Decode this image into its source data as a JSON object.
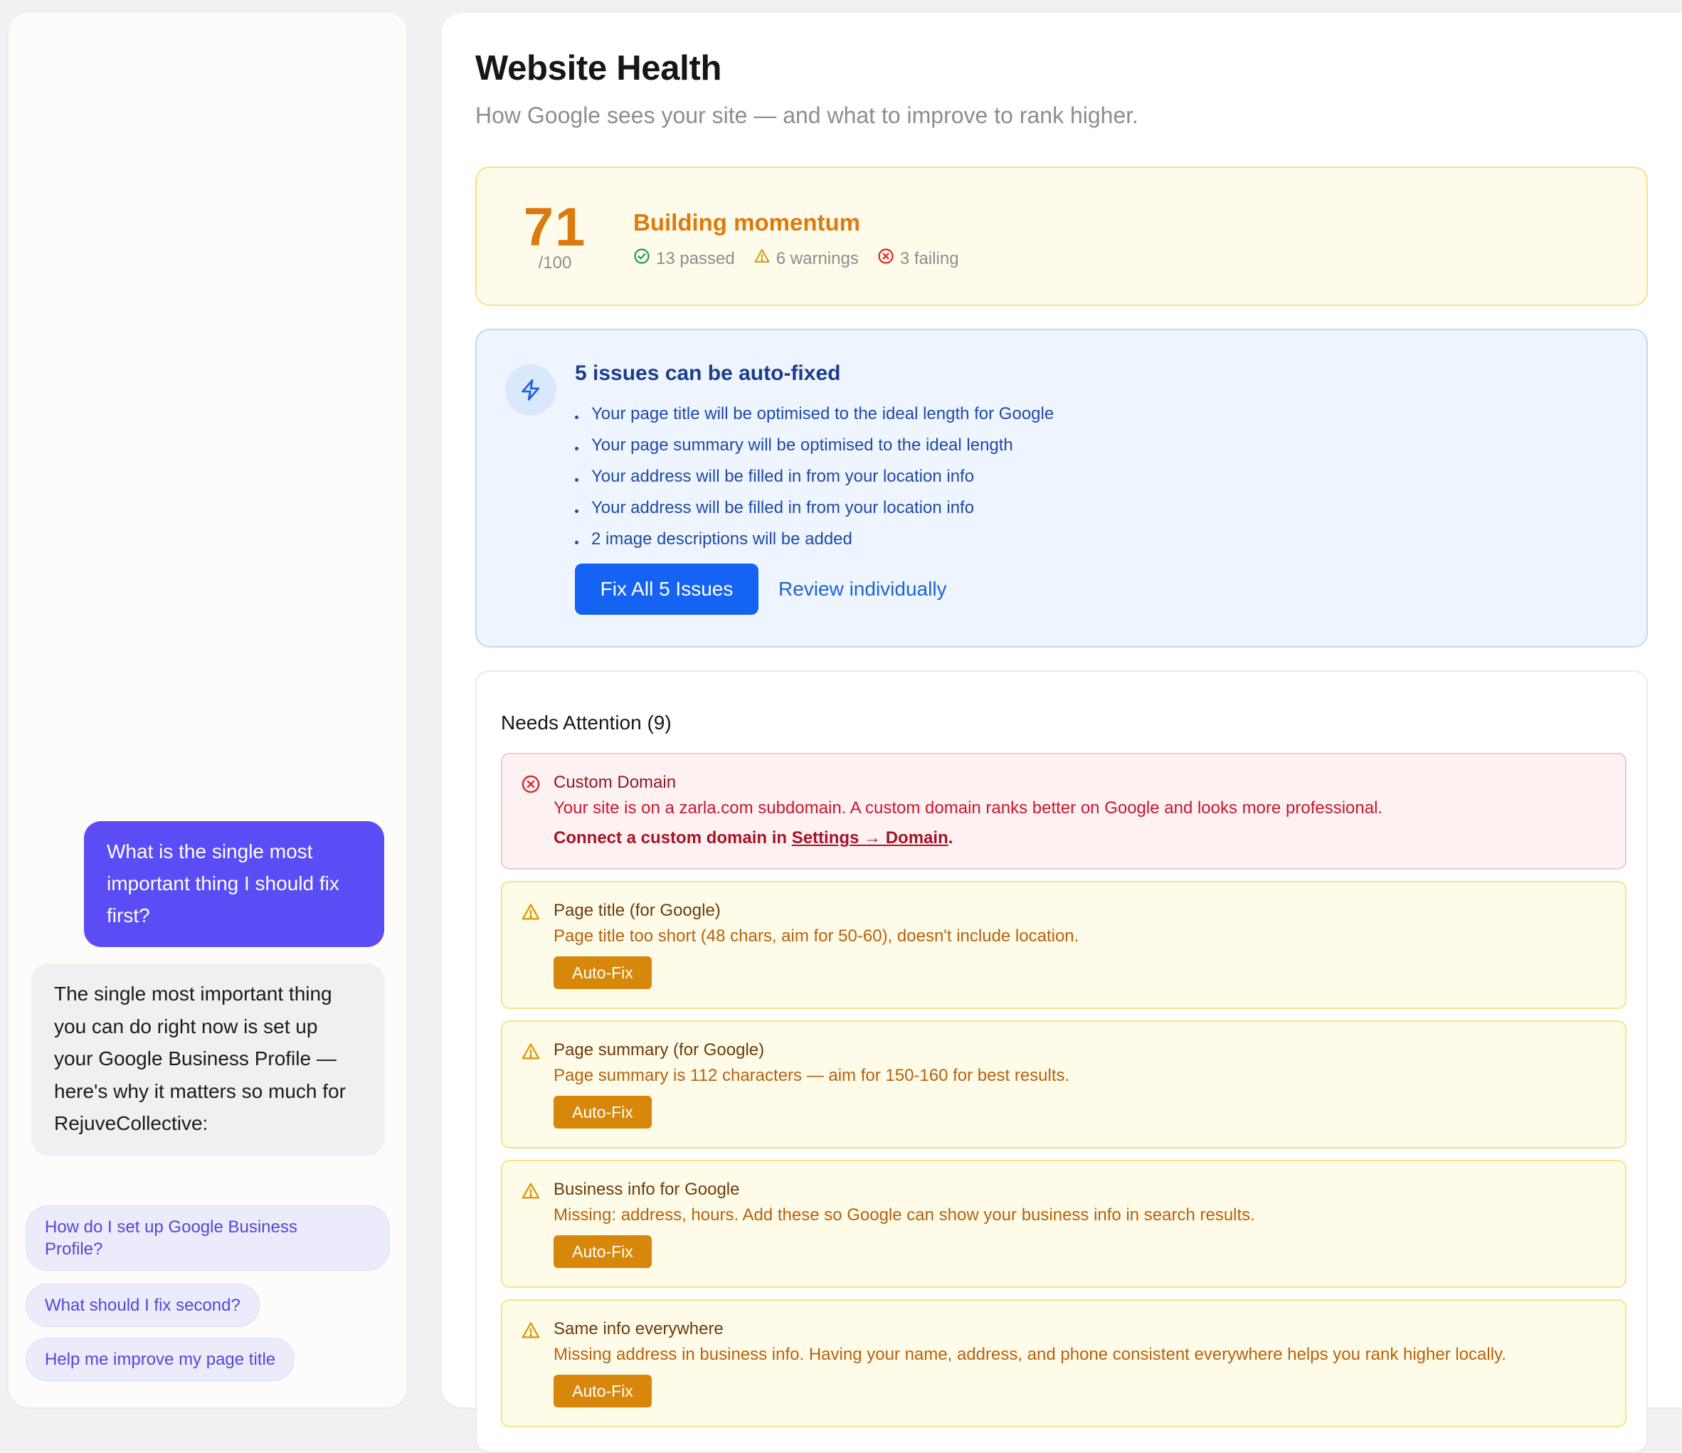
{
  "chat": {
    "user_message": "What is the single most important thing I should fix first?",
    "bot_message": "The single most important thing you can do right now is set up your Google Business Profile — here's why it matters so much for RejuveCollective:",
    "suggestions": [
      "How do I set up Google Business Profile?",
      "What should I fix second?",
      "Help me improve my page title"
    ]
  },
  "header": {
    "title": "Website Health",
    "subtitle": "How Google sees your site — and what to improve to rank higher."
  },
  "score": {
    "value": "71",
    "max": "/100",
    "label": "Building momentum",
    "passed": "13 passed",
    "warnings": "6 warnings",
    "failing": "3 failing",
    "colors": {
      "accent": "#dd7a0c",
      "pass": "#16a34a",
      "warn": "#d89a0a",
      "fail": "#dc2626"
    }
  },
  "autofix": {
    "title": "5 issues can be auto-fixed",
    "items": [
      "Your page title will be optimised to the ideal length for Google",
      "Your page summary will be optimised to the ideal length",
      "Your address will be filled in from your location info",
      "Your address will be filled in from your location info",
      "2 image descriptions will be added"
    ],
    "primary_button": "Fix All 5 Issues",
    "secondary_link": "Review individually",
    "icon": "bolt-icon"
  },
  "attention": {
    "title": "Needs Attention (9)",
    "error_issue": {
      "name": "Custom Domain",
      "description": "Your site is on a zarla.com subdomain. A custom domain ranks better on Google and looks more professional.",
      "cta_prefix": "Connect a custom domain in ",
      "cta_link": "Settings → Domain",
      "cta_suffix": "."
    },
    "warning_issues": [
      {
        "name": "Page title (for Google)",
        "description": "Page title too short (48 chars, aim for 50-60), doesn't include location.",
        "button": "Auto-Fix"
      },
      {
        "name": "Page summary (for Google)",
        "description": "Page summary is 112 characters — aim for 150-160 for best results.",
        "button": "Auto-Fix"
      },
      {
        "name": "Business info for Google",
        "description": "Missing: address, hours. Add these so Google can show your business info in search results.",
        "button": "Auto-Fix"
      },
      {
        "name": "Same info everywhere",
        "description": "Missing address in business info. Having your name, address, and phone consistent everywhere helps you rank higher locally.",
        "button": "Auto-Fix"
      }
    ]
  }
}
